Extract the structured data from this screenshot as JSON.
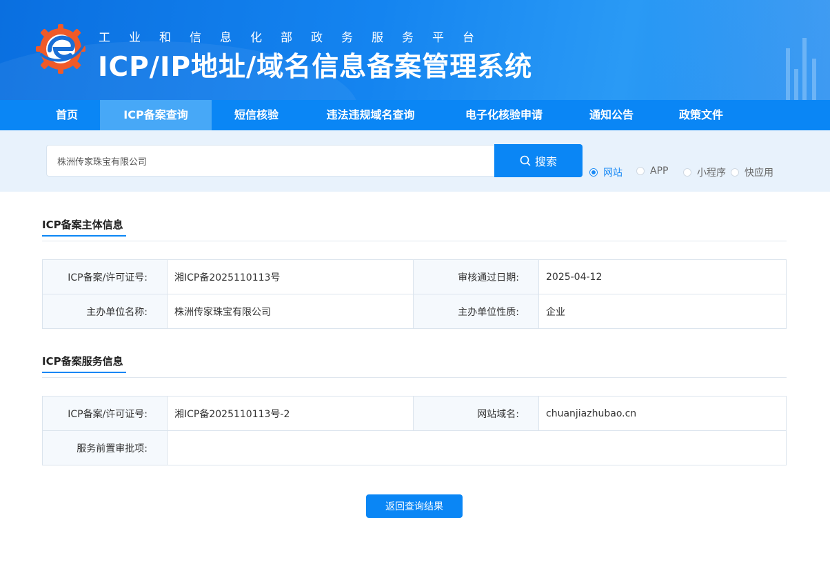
{
  "header": {
    "subtitle": "工业和信息化部政务服务平台",
    "title": "ICP/IP地址/域名信息备案管理系统"
  },
  "nav": {
    "items": [
      {
        "label": "首页"
      },
      {
        "label": "ICP备案查询"
      },
      {
        "label": "短信核验"
      },
      {
        "label": "违法违规域名查询"
      },
      {
        "label": "电子化核验申请"
      },
      {
        "label": "通知公告"
      },
      {
        "label": "政策文件"
      }
    ],
    "active": "ICP备案查询"
  },
  "search": {
    "value": "株洲传家珠宝有限公司",
    "button_label": "搜索",
    "types": [
      {
        "label": "网站",
        "checked": true
      },
      {
        "label": "APP",
        "checked": false
      },
      {
        "label": "小程序",
        "checked": false
      },
      {
        "label": "快应用",
        "checked": false
      }
    ]
  },
  "subject_section": {
    "title": "ICP备案主体信息",
    "license_label": "ICP备案/许可证号:",
    "license_value": "湘ICP备2025110113号",
    "approve_date_label": "审核通过日期:",
    "approve_date_value": "2025-04-12",
    "org_name_label": "主办单位名称:",
    "org_name_value": "株洲传家珠宝有限公司",
    "org_type_label": "主办单位性质:",
    "org_type_value": "企业"
  },
  "service_section": {
    "title": "ICP备案服务信息",
    "license_label": "ICP备案/许可证号:",
    "license_value": "湘ICP备2025110113号-2",
    "domain_label": "网站域名:",
    "domain_value": "chuanjiazhubao.cn",
    "preapproval_label": "服务前置审批项:",
    "preapproval_value": ""
  },
  "back_button_label": "返回查询结果",
  "colors": {
    "primary": "#0a86f5",
    "nav_active": "#47a8f7",
    "search_band": "#e8f2fc",
    "label_bg": "#f5f9fd"
  }
}
